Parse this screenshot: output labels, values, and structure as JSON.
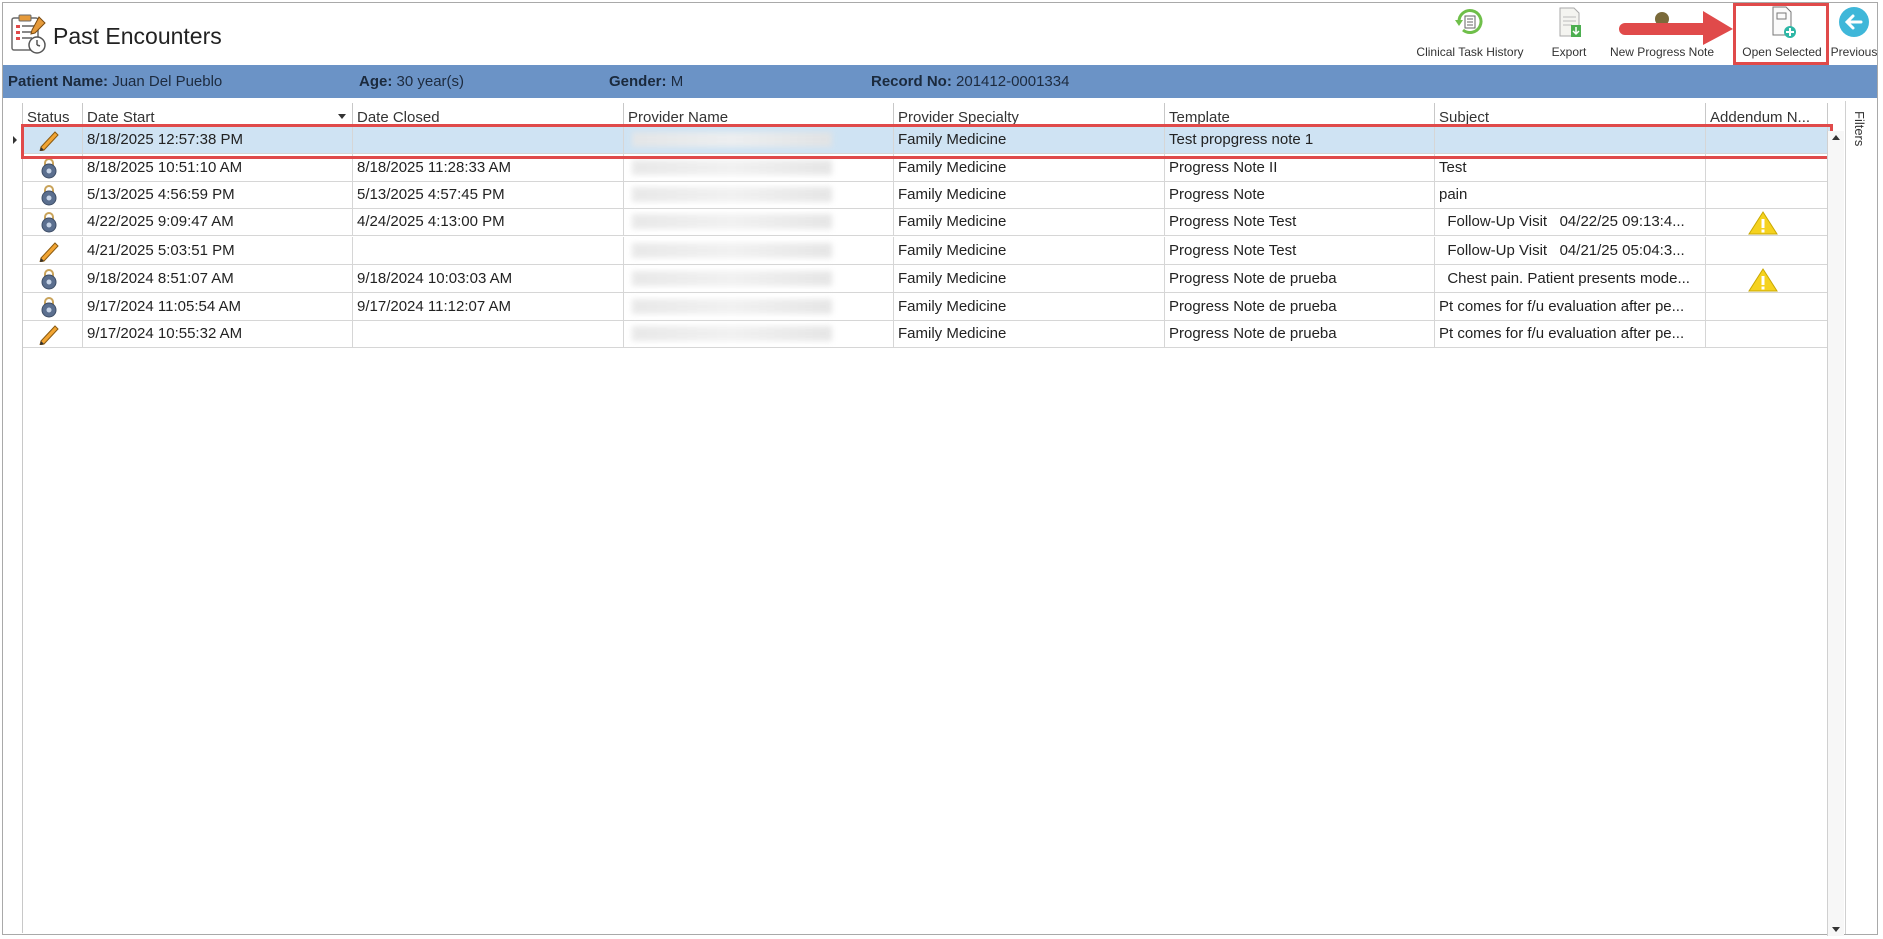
{
  "header": {
    "title": "Past Encounters"
  },
  "toolbar": {
    "clinical_task_history": "Clinical Task History",
    "export": "Export",
    "new_progress_note": "New Progress Note",
    "open_selected": "Open Selected",
    "previous": "Previous"
  },
  "patient": {
    "name_label": "Patient Name:",
    "name_value": "Juan Del Pueblo",
    "age_label": "Age:",
    "age_value": "30 year(s)",
    "gender_label": "Gender:",
    "gender_value": "M",
    "record_label": "Record No:",
    "record_value": "201412-0001334"
  },
  "grid": {
    "columns": [
      "Status",
      "Date Start",
      "Date Closed",
      "Provider Name",
      "Provider Specialty",
      "Template",
      "Subject",
      "Addendum N..."
    ],
    "rows": [
      {
        "status": "pencil-icon",
        "date_start": "8/18/2025 12:57:38 PM",
        "date_closed": "",
        "specialty": "Family Medicine",
        "template": "Test propgress note 1",
        "subject": "",
        "addendum": ""
      },
      {
        "status": "lock-icon",
        "date_start": "8/18/2025 10:51:10 AM",
        "date_closed": "8/18/2025 11:28:33 AM",
        "specialty": "Family Medicine",
        "template": "Progress Note II",
        "subject": "Test",
        "addendum": ""
      },
      {
        "status": "lock-icon",
        "date_start": "5/13/2025 4:56:59 PM",
        "date_closed": "5/13/2025 4:57:45 PM",
        "specialty": "Family Medicine",
        "template": "Progress Note",
        "subject": "pain",
        "addendum": ""
      },
      {
        "status": "lock-icon",
        "date_start": "4/22/2025 9:09:47 AM",
        "date_closed": "4/24/2025 4:13:00 PM",
        "specialty": "Family Medicine",
        "template": "Progress Note Test",
        "subject": "  Follow-Up Visit   04/22/25 09:13:4...",
        "addendum": "warning-icon"
      },
      {
        "status": "pencil-icon",
        "date_start": "4/21/2025 5:03:51 PM",
        "date_closed": "",
        "specialty": "Family Medicine",
        "template": "Progress Note Test",
        "subject": "  Follow-Up Visit   04/21/25 05:04:3...",
        "addendum": ""
      },
      {
        "status": "lock-icon",
        "date_start": "9/18/2024 8:51:07 AM",
        "date_closed": "9/18/2024 10:03:03 AM",
        "specialty": "Family Medicine",
        "template": "Progress Note de prueba",
        "subject": "  Chest pain. Patient presents mode...",
        "addendum": "warning-icon"
      },
      {
        "status": "lock-icon",
        "date_start": "9/17/2024 11:05:54 AM",
        "date_closed": "9/17/2024 11:12:07 AM",
        "specialty": "Family Medicine",
        "template": "Progress Note de prueba",
        "subject": "Pt comes for f/u evaluation after pe...",
        "addendum": ""
      },
      {
        "status": "pencil-icon",
        "date_start": "9/17/2024 10:55:32 AM",
        "date_closed": "",
        "specialty": "Family Medicine",
        "template": "Progress Note de prueba",
        "subject": "Pt comes for f/u evaluation after pe...",
        "addendum": ""
      }
    ]
  },
  "sidebar": {
    "filters": "Filters"
  },
  "colors": {
    "patient_bar": "#6b93c6",
    "selected_row": "#cfe3f3",
    "highlight": "#e04a4a"
  }
}
